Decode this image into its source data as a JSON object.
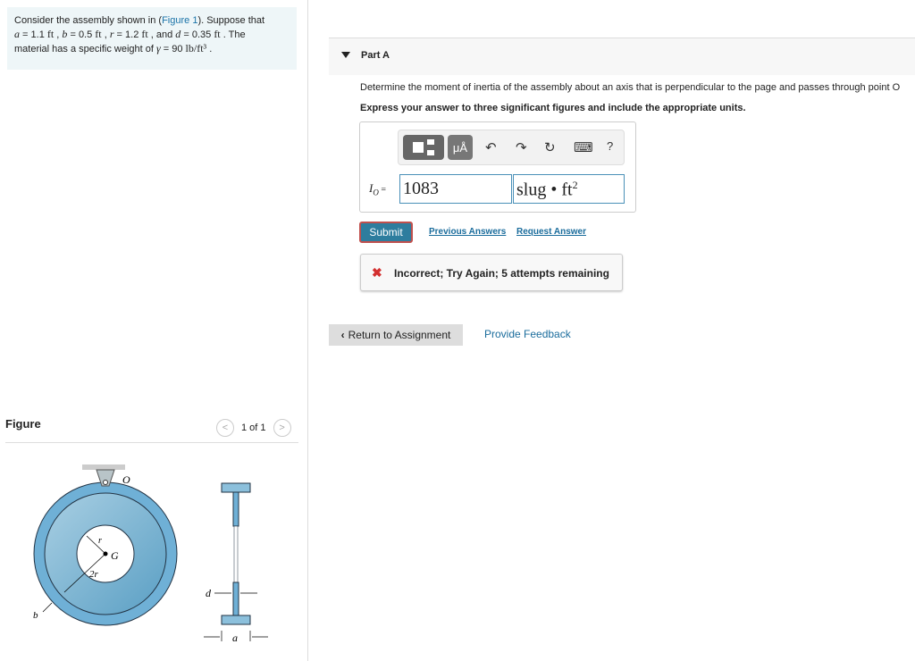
{
  "problem": {
    "intro": "Consider the assembly shown in (",
    "figure_link": "Figure 1",
    "after_link": "). Suppose that",
    "a": "a",
    "a_val": " = 1.1 ",
    "unit": "ft",
    "b": "b",
    "b_val": " = 0.5 ",
    "r": "r",
    "r_val": " = 1.2 ",
    "and": " , and ",
    "d": "d",
    "d_val": " = 0.35 ",
    "the": " . The",
    "line3": "material has a specific weight of ",
    "gamma": "γ",
    "gamma_val": " = 90 ",
    "gamma_unit": "lb/ft³",
    "period": " ."
  },
  "figure": {
    "heading": "Figure",
    "pager": "1 of 1",
    "labels": {
      "O": "O",
      "G": "G",
      "r": "r",
      "two_r": "2r",
      "b": "b",
      "d": "d",
      "a": "a"
    }
  },
  "part": {
    "title": "Part A",
    "question": "Determine the moment of inertia of the assembly about an axis that is perpendicular to the page and passes through point O",
    "instruction": "Express your answer to three significant figures and include the appropriate units."
  },
  "answer": {
    "label": "I",
    "label_sub": "O",
    "equals": " =",
    "value": "1083",
    "units": "slug • ft",
    "units_sup": "2",
    "toolbar": {
      "units_btn": "μÅ",
      "undo": "↶",
      "redo": "↷",
      "reset": "↻",
      "keyboard": "⌨",
      "help": "?"
    }
  },
  "actions": {
    "submit": "Submit",
    "previous": "Previous Answers",
    "request": "Request Answer"
  },
  "feedback": {
    "icon": "✖",
    "text": "Incorrect; Try Again; 5 attempts remaining",
    "color": "#d32f2f"
  },
  "footer": {
    "return": "Return to Assignment",
    "provide": "Provide Feedback"
  }
}
